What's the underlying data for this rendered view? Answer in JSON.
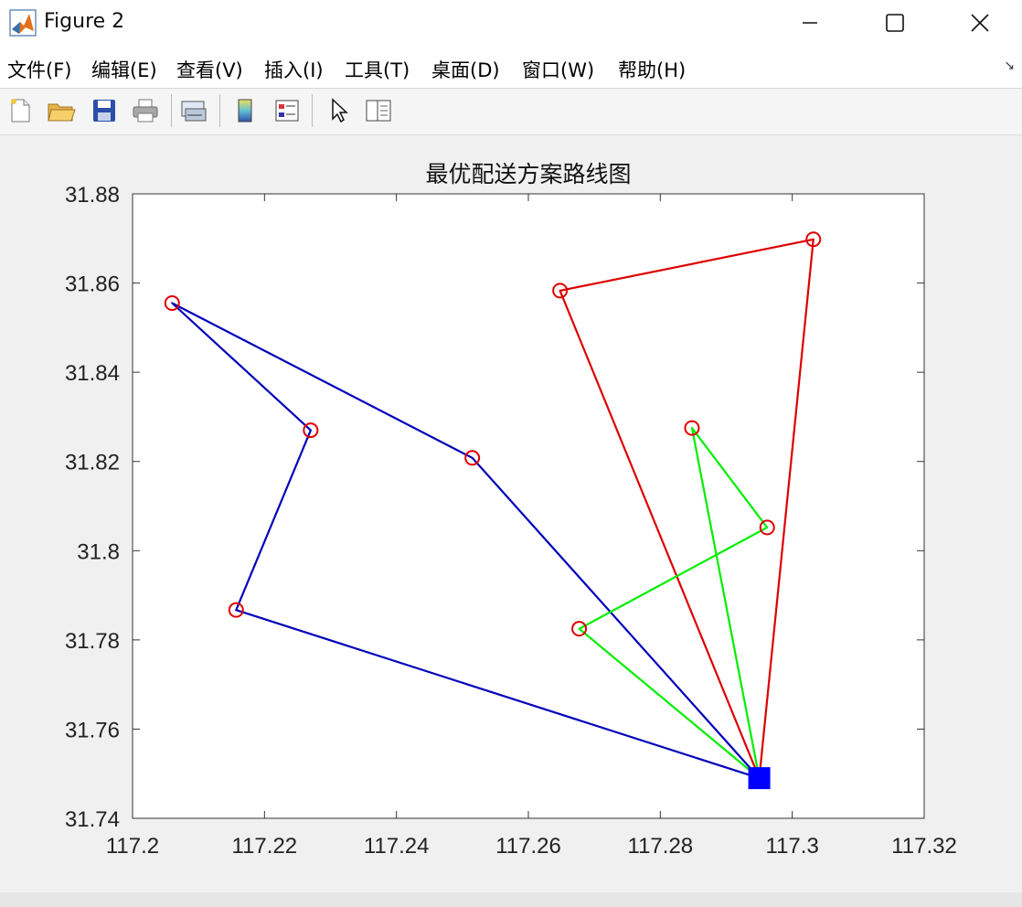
{
  "window": {
    "title": "Figure 2",
    "controls": {
      "minimize": "—",
      "maximize": "☐",
      "close": "✕"
    }
  },
  "menu": {
    "items": [
      {
        "label": "文件(F)"
      },
      {
        "label": "编辑(E)"
      },
      {
        "label": "查看(V)"
      },
      {
        "label": "插入(I)"
      },
      {
        "label": "工具(T)"
      },
      {
        "label": "桌面(D)"
      },
      {
        "label": "窗口(W)"
      },
      {
        "label": "帮助(H)"
      }
    ],
    "dock_arrow": "↘"
  },
  "toolbar": {
    "buttons": [
      {
        "icon": "new-figure-icon"
      },
      {
        "icon": "open-file-icon"
      },
      {
        "icon": "save-icon"
      },
      {
        "icon": "print-icon"
      },
      {
        "icon": "link-plot-icon"
      },
      {
        "icon": "colorbar-icon"
      },
      {
        "icon": "legend-icon"
      },
      {
        "icon": "pointer-icon"
      },
      {
        "icon": "property-editor-icon"
      }
    ]
  },
  "chart_data": {
    "type": "line",
    "title": "最优配送方案路线图",
    "xlabel": "",
    "ylabel": "",
    "xlim": [
      117.2,
      117.32
    ],
    "ylim": [
      31.74,
      31.88
    ],
    "xticks": [
      117.2,
      117.22,
      117.24,
      117.26,
      117.28,
      117.3,
      117.32
    ],
    "xtick_labels": [
      "117.2",
      "117.22",
      "117.24",
      "117.26",
      "117.28",
      "117.3",
      "117.32"
    ],
    "yticks": [
      31.74,
      31.76,
      31.78,
      31.8,
      31.82,
      31.84,
      31.86,
      31.88
    ],
    "ytick_labels": [
      "31.74",
      "31.76",
      "31.78",
      "31.8",
      "31.82",
      "31.84",
      "31.86",
      "31.88"
    ],
    "grid": false,
    "depot": {
      "x": 117.295,
      "y": 31.749,
      "color": "#0000ff",
      "marker": "square"
    },
    "customer_marker_color": "#e00000",
    "routes": [
      {
        "color": "#0000bb",
        "points": [
          [
            117.295,
            31.749
          ],
          [
            117.2515,
            31.8208
          ],
          [
            117.206,
            31.8555
          ],
          [
            117.227,
            31.827
          ],
          [
            117.2157,
            31.7867
          ],
          [
            117.295,
            31.749
          ]
        ]
      },
      {
        "color": "#dd0000",
        "points": [
          [
            117.295,
            31.749
          ],
          [
            117.2648,
            31.8583
          ],
          [
            117.3032,
            31.8698
          ],
          [
            117.295,
            31.749
          ]
        ]
      },
      {
        "color": "#00ee00",
        "points": [
          [
            117.295,
            31.749
          ],
          [
            117.2848,
            31.8275
          ],
          [
            117.2962,
            31.8052
          ],
          [
            117.2677,
            31.7825
          ],
          [
            117.295,
            31.749
          ]
        ]
      }
    ]
  }
}
